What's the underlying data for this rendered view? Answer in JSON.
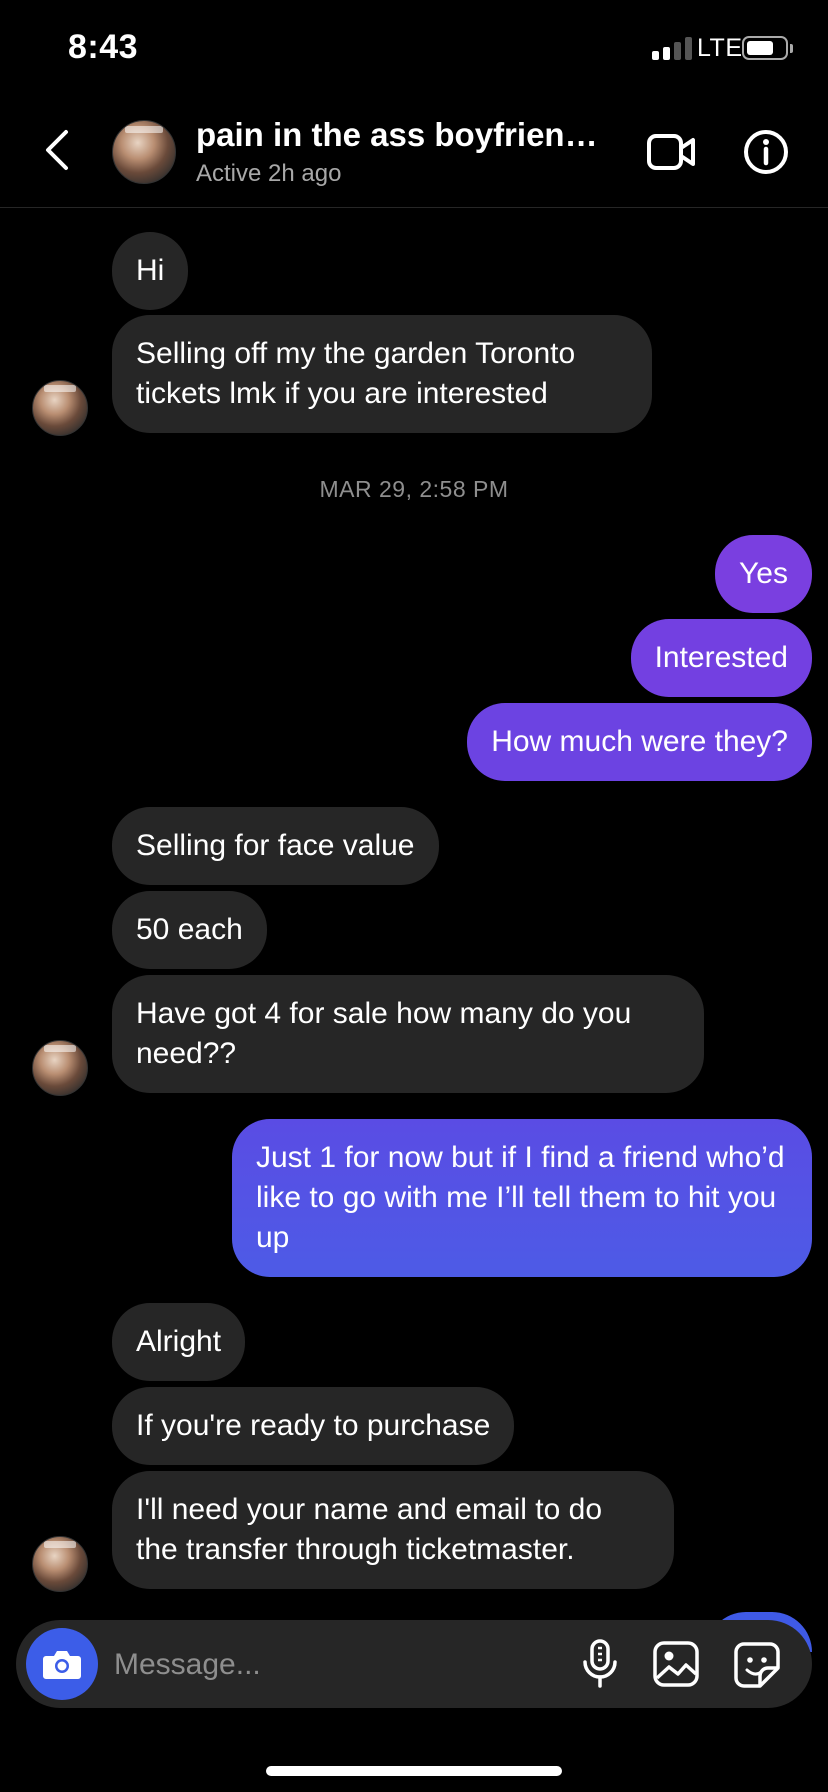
{
  "status_bar": {
    "time": "8:43",
    "network": "LTE"
  },
  "header": {
    "title": "pain in the ass boyfriend…",
    "subtitle": "Active 2h ago",
    "avatar_icon": "profile-avatar-icon",
    "back_icon": "chevron-left-icon",
    "video_icon": "video-camera-icon",
    "info_icon": "info-icon"
  },
  "thread": {
    "timestamp": "MAR 29, 2:58 PM",
    "messages": [
      {
        "from": "them",
        "text": "Hi"
      },
      {
        "from": "them",
        "text": "Selling off my the garden Toronto tickets lmk if you are interested"
      },
      {
        "from": "me",
        "text": "Yes"
      },
      {
        "from": "me",
        "text": "Interested"
      },
      {
        "from": "me",
        "text": "How much were they?"
      },
      {
        "from": "them",
        "text": "Selling for face value"
      },
      {
        "from": "them",
        "text": "50 each"
      },
      {
        "from": "them",
        "text": "Have got 4 for sale how many do you need??"
      },
      {
        "from": "me",
        "text": "Just 1 for now but if I find a friend who’d like to go with me I’ll tell them to hit you up"
      },
      {
        "from": "them",
        "text": "Alright"
      },
      {
        "from": "them",
        "text": "If you're ready to purchase"
      },
      {
        "from": "them",
        "text": "I'll need your name and email to do the transfer through ticketmaster."
      }
    ]
  },
  "composer": {
    "placeholder": "Message...",
    "camera_icon": "camera-icon",
    "mic_icon": "microphone-icon",
    "gallery_icon": "image-gallery-icon",
    "sticker_icon": "sticker-icon"
  },
  "colors": {
    "background": "#000000",
    "incoming_bubble": "#262626",
    "outgoing_bubble_top": "#7a3fe0",
    "outgoing_bubble_bottom": "#4b5ee6",
    "camera_button": "#3c5de8",
    "secondary_text": "#8e8e8e"
  }
}
